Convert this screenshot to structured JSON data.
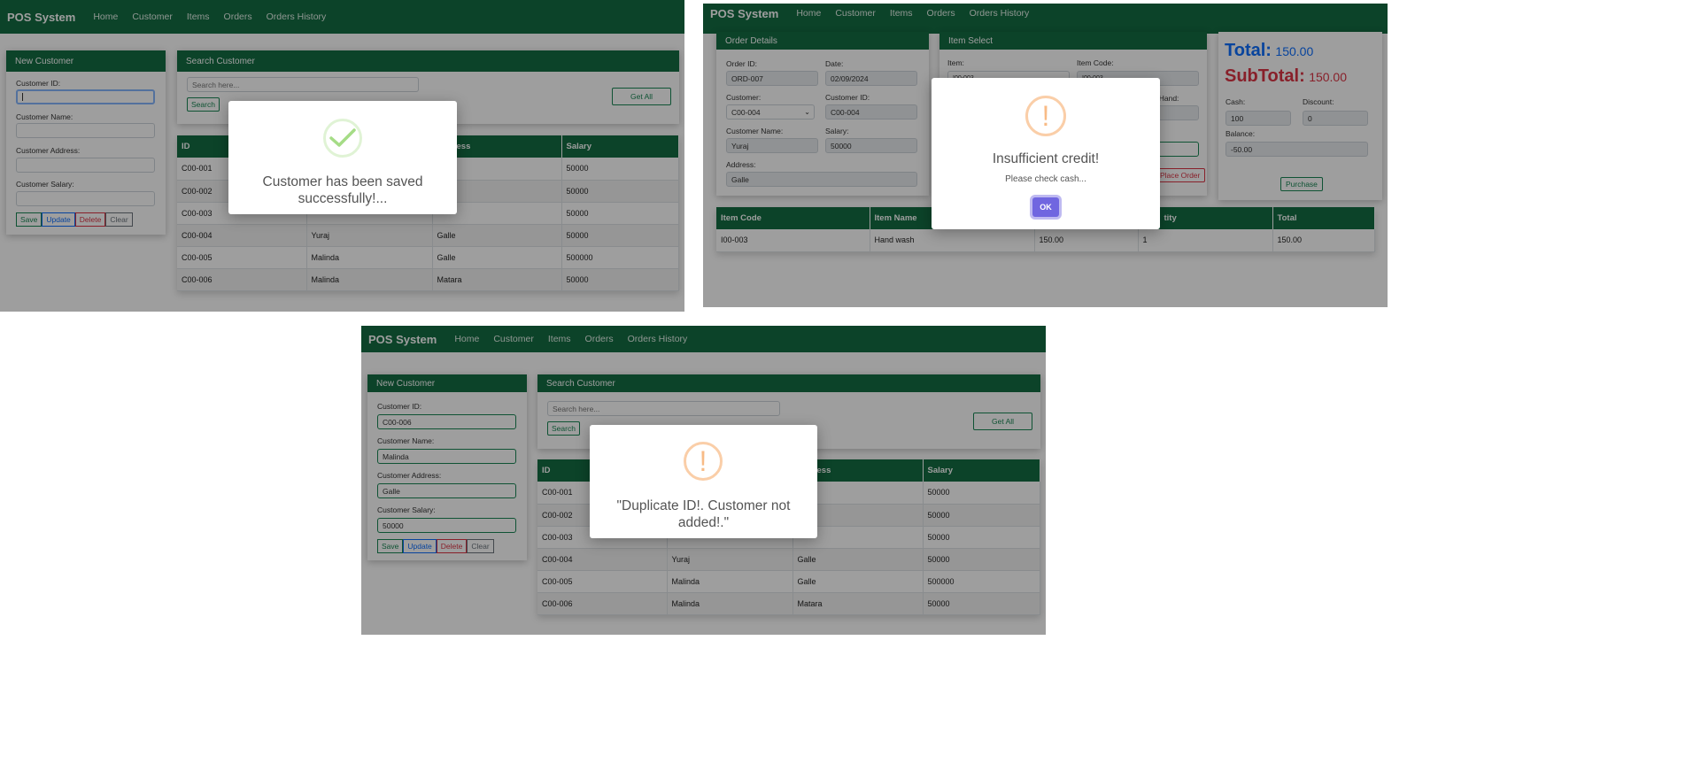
{
  "nav": {
    "brand": "POS System",
    "links": [
      "Home",
      "Customer",
      "Items",
      "Orders",
      "Orders History"
    ]
  },
  "customer_form": {
    "title": "New Customer",
    "id_label": "Customer ID:",
    "name_label": "Customer Name:",
    "address_label": "Customer Address:",
    "salary_label": "Customer Salary:",
    "buttons": {
      "save": "Save",
      "update": "Update",
      "delete": "Delete",
      "clear": "Clear"
    }
  },
  "customer_form_filled": {
    "id_value": "C00-006",
    "name_value": "Malinda",
    "address_value": "Galle",
    "salary_value": "50000"
  },
  "search": {
    "title": "Search Customer",
    "placeholder": "Search here...",
    "search_button": "Search",
    "get_all_button": "Get All"
  },
  "customer_table": {
    "headers": [
      "ID",
      "Name",
      "Address",
      "Salary"
    ],
    "rows": [
      [
        "C00-001",
        "",
        "",
        "50000"
      ],
      [
        "C00-002",
        "",
        "",
        "50000"
      ],
      [
        "C00-003",
        "",
        "",
        "50000"
      ],
      [
        "C00-004",
        "Yuraj",
        "Galle",
        "50000"
      ],
      [
        "C00-005",
        "Malinda",
        "Galle",
        "500000"
      ],
      [
        "C00-006",
        "Malinda",
        "Matara",
        "50000"
      ]
    ],
    "visible_header_fragment": "ess"
  },
  "orders": {
    "details_title": "Order Details",
    "order_id_label": "Order ID:",
    "order_id_value": "ORD-007",
    "date_label": "Date:",
    "date_value": "02/09/2024",
    "customer_label": "Customer:",
    "customer_value": "C00-004",
    "customer_id_label": "Customer ID:",
    "customer_id_value": "C00-004",
    "customer_name_label": "Customer Name:",
    "customer_name_value": "Yuraj",
    "salary_label": "Salary:",
    "salary_value": "50000",
    "address_label": "Address:",
    "address_value": "Galle",
    "item_select_title": "Item Select",
    "item_label": "Item:",
    "item_code_label": "Item Code:",
    "item_partial": "I00-003",
    "onhand_fragment": "nHand:",
    "place_order_button": "Place Order",
    "total_label": "Total:",
    "total_value": "150.00",
    "subtotal_label": "SubTotal:",
    "subtotal_value": "150.00",
    "cash_label": "Cash:",
    "cash_value": "100",
    "discount_label": "Discount:",
    "discount_value": "0",
    "balance_label": "Balance:",
    "balance_value": "-50.00",
    "purchase_button": "Purchase",
    "cart_headers": [
      "Item Code",
      "Item Name",
      "",
      "tity",
      "Total"
    ],
    "cart_rows": [
      [
        "I00-003",
        "Hand wash",
        "150.00",
        "1",
        "150.00"
      ]
    ]
  },
  "alerts": {
    "saved": "Customer has been saved successfully!...",
    "insufficient_title": "Insufficient credit!",
    "insufficient_text": "Please check cash...",
    "ok_button": "OK",
    "duplicate": "\"Duplicate ID!. Customer not added!.\""
  },
  "colors": {
    "brand_green": "#146c43",
    "success_icon": "#a5dc86",
    "warning_icon": "#f8bb86",
    "ok_button": "#7066e0",
    "total_blue": "#0d6efd",
    "subtotal_red": "#dc3545"
  },
  "icons": {
    "success": "check-icon",
    "warning": "exclamation-icon",
    "dropdown": "chevron-down-icon"
  }
}
